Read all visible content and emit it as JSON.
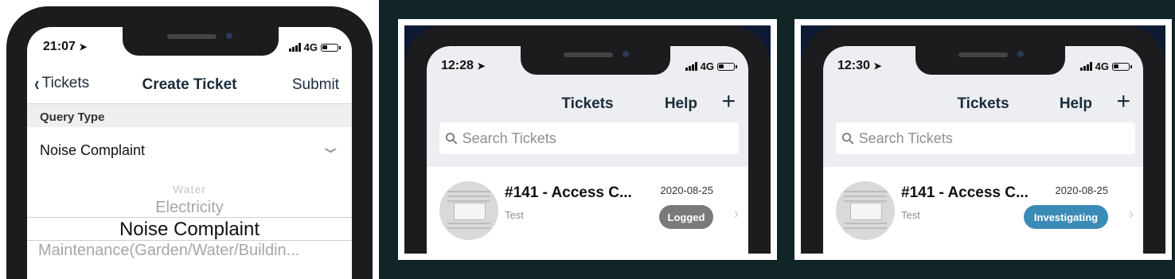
{
  "screen1": {
    "time": "21:07",
    "network": "4G",
    "nav": {
      "back_label": "Tickets",
      "title": "Create Ticket",
      "submit_label": "Submit"
    },
    "section_header": "Query Type",
    "selected_value": "Noise Complaint",
    "picker_options": [
      "Water",
      "Electricity",
      "Noise Complaint",
      "Maintenance(Garden/Water/Buildin..."
    ]
  },
  "screen2": {
    "time": "12:28",
    "network": "4G",
    "nav": {
      "title": "Tickets",
      "help_label": "Help",
      "add_label": "+"
    },
    "search": {
      "placeholder": "Search Tickets"
    },
    "ticket": {
      "title": "#141 - Access C...",
      "date": "2020-08-25",
      "subtitle": "Test",
      "status": "Logged",
      "status_color": "#7a7a7a"
    }
  },
  "screen3": {
    "time": "12:30",
    "network": "4G",
    "nav": {
      "title": "Tickets",
      "help_label": "Help",
      "add_label": "+"
    },
    "search": {
      "placeholder": "Search Tickets"
    },
    "ticket": {
      "title": "#141 - Access C...",
      "date": "2020-08-25",
      "subtitle": "Test",
      "status": "Investigating",
      "status_color": "#3a8bb5"
    }
  }
}
